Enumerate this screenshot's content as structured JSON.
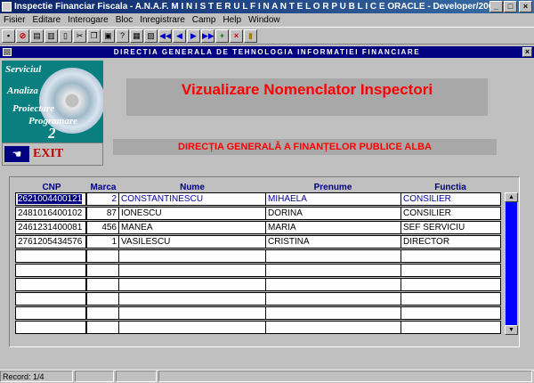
{
  "window": {
    "title": "Inspectie Financiar Fiscala - A.N.A.F.  M I N I S T E R U L   F I N A N T E L O R   P U B L I C E  ORACLE - Developer/2000"
  },
  "menu": [
    "Fisier",
    "Editare",
    "Interogare",
    "Bloc",
    "Inregistrare",
    "Camp",
    "Help",
    "Window"
  ],
  "inner_window": {
    "title": "DIRECTIA GENERALA DE TEHNOLOGIA INFORMATIEI FINANCIARE"
  },
  "logo": {
    "line1": "Serviciul",
    "line2": "Analiza",
    "line3": "Proiectare",
    "line4": "Programare",
    "num": "2"
  },
  "exit": {
    "label": "EXIT"
  },
  "header": {
    "title": "Vizualizare Nomenclator Inspectori",
    "subtitle": "DIRECȚIA GENERALĂ A FINANȚELOR PUBLICE ALBA"
  },
  "table": {
    "columns": [
      "CNP",
      "Marca",
      "Nume",
      "Prenume",
      "Functia"
    ],
    "rows": [
      {
        "cnp": "2621004400121",
        "marca": "2",
        "nume": "CONSTANTINESCU",
        "prenume": "MIHAELA",
        "functia": "CONSILIER"
      },
      {
        "cnp": "2481016400102",
        "marca": "87",
        "nume": "IONESCU",
        "prenume": "DORINA",
        "functia": "CONSILIER"
      },
      {
        "cnp": "2461231400081",
        "marca": "456",
        "nume": "MANEA",
        "prenume": "MARIA",
        "functia": "SEF SERVICIU"
      },
      {
        "cnp": "2761205434576",
        "marca": "1",
        "nume": "VASILESCU",
        "prenume": "CRISTINA",
        "functia": "DIRECTOR"
      }
    ]
  },
  "status": {
    "record": "Record: 1/4"
  },
  "colors": {
    "title_red": "#ff0000",
    "header_blue": "#000080",
    "scroll_thumb": "#0000ff"
  }
}
